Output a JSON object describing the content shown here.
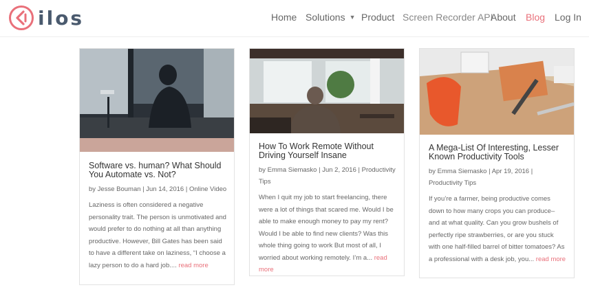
{
  "brand": {
    "name": "ilos",
    "accent": "#e9707a",
    "text_color": "#4a5a6e"
  },
  "nav": {
    "items": [
      {
        "label": "Home",
        "has_dropdown": false
      },
      {
        "label": "Solutions",
        "has_dropdown": true
      },
      {
        "label": "Product",
        "has_dropdown": false
      },
      {
        "label": "Screen Recorder API",
        "has_dropdown": false
      },
      {
        "label": "About",
        "has_dropdown": false
      },
      {
        "label": "Blog",
        "has_dropdown": false,
        "active": true
      },
      {
        "label": "Log In",
        "has_dropdown": false
      }
    ],
    "dropdown_icon": "chevron-down-icon"
  },
  "posts": [
    {
      "title": "Software vs. human? What Should You Automate vs. Not?",
      "meta": "by Jesse Bouman | Jun 14, 2016 | Online Video",
      "excerpt": "Laziness is often considered a negative personality trait. The person is unmotivated and would prefer to do nothing at all than anything productive. However, Bill Gates has been said to have a different take on laziness, “I choose a lazy person to do a hard job....",
      "read_more": "read more"
    },
    {
      "title": "How To Work Remote Without Driving Yourself Insane",
      "meta": "by Emma Siemasko | Jun 2, 2016 | Productivity Tips",
      "excerpt": "When I quit my job to start freelancing, there were a lot of things that scared me. Would I be able to make enough money to pay my rent? Would I be able to find new clients? Was this whole thing going to work But most of all, I worried about working remotely. I’m a...",
      "read_more": "read more"
    },
    {
      "title": "A Mega-List Of Interesting, Lesser Known Productivity Tools",
      "meta": "by Emma Siemasko | Apr 19, 2016 | Productivity Tips",
      "excerpt": "If you’re a farmer, being productive comes down to how many crops you can produce– and at what quality. Can you grow bushels of perfectly ripe strawberries, or are you stuck with one half-filled barrel of bitter tomatoes? As a professional with a desk job, you...",
      "read_more": "read more"
    }
  ]
}
